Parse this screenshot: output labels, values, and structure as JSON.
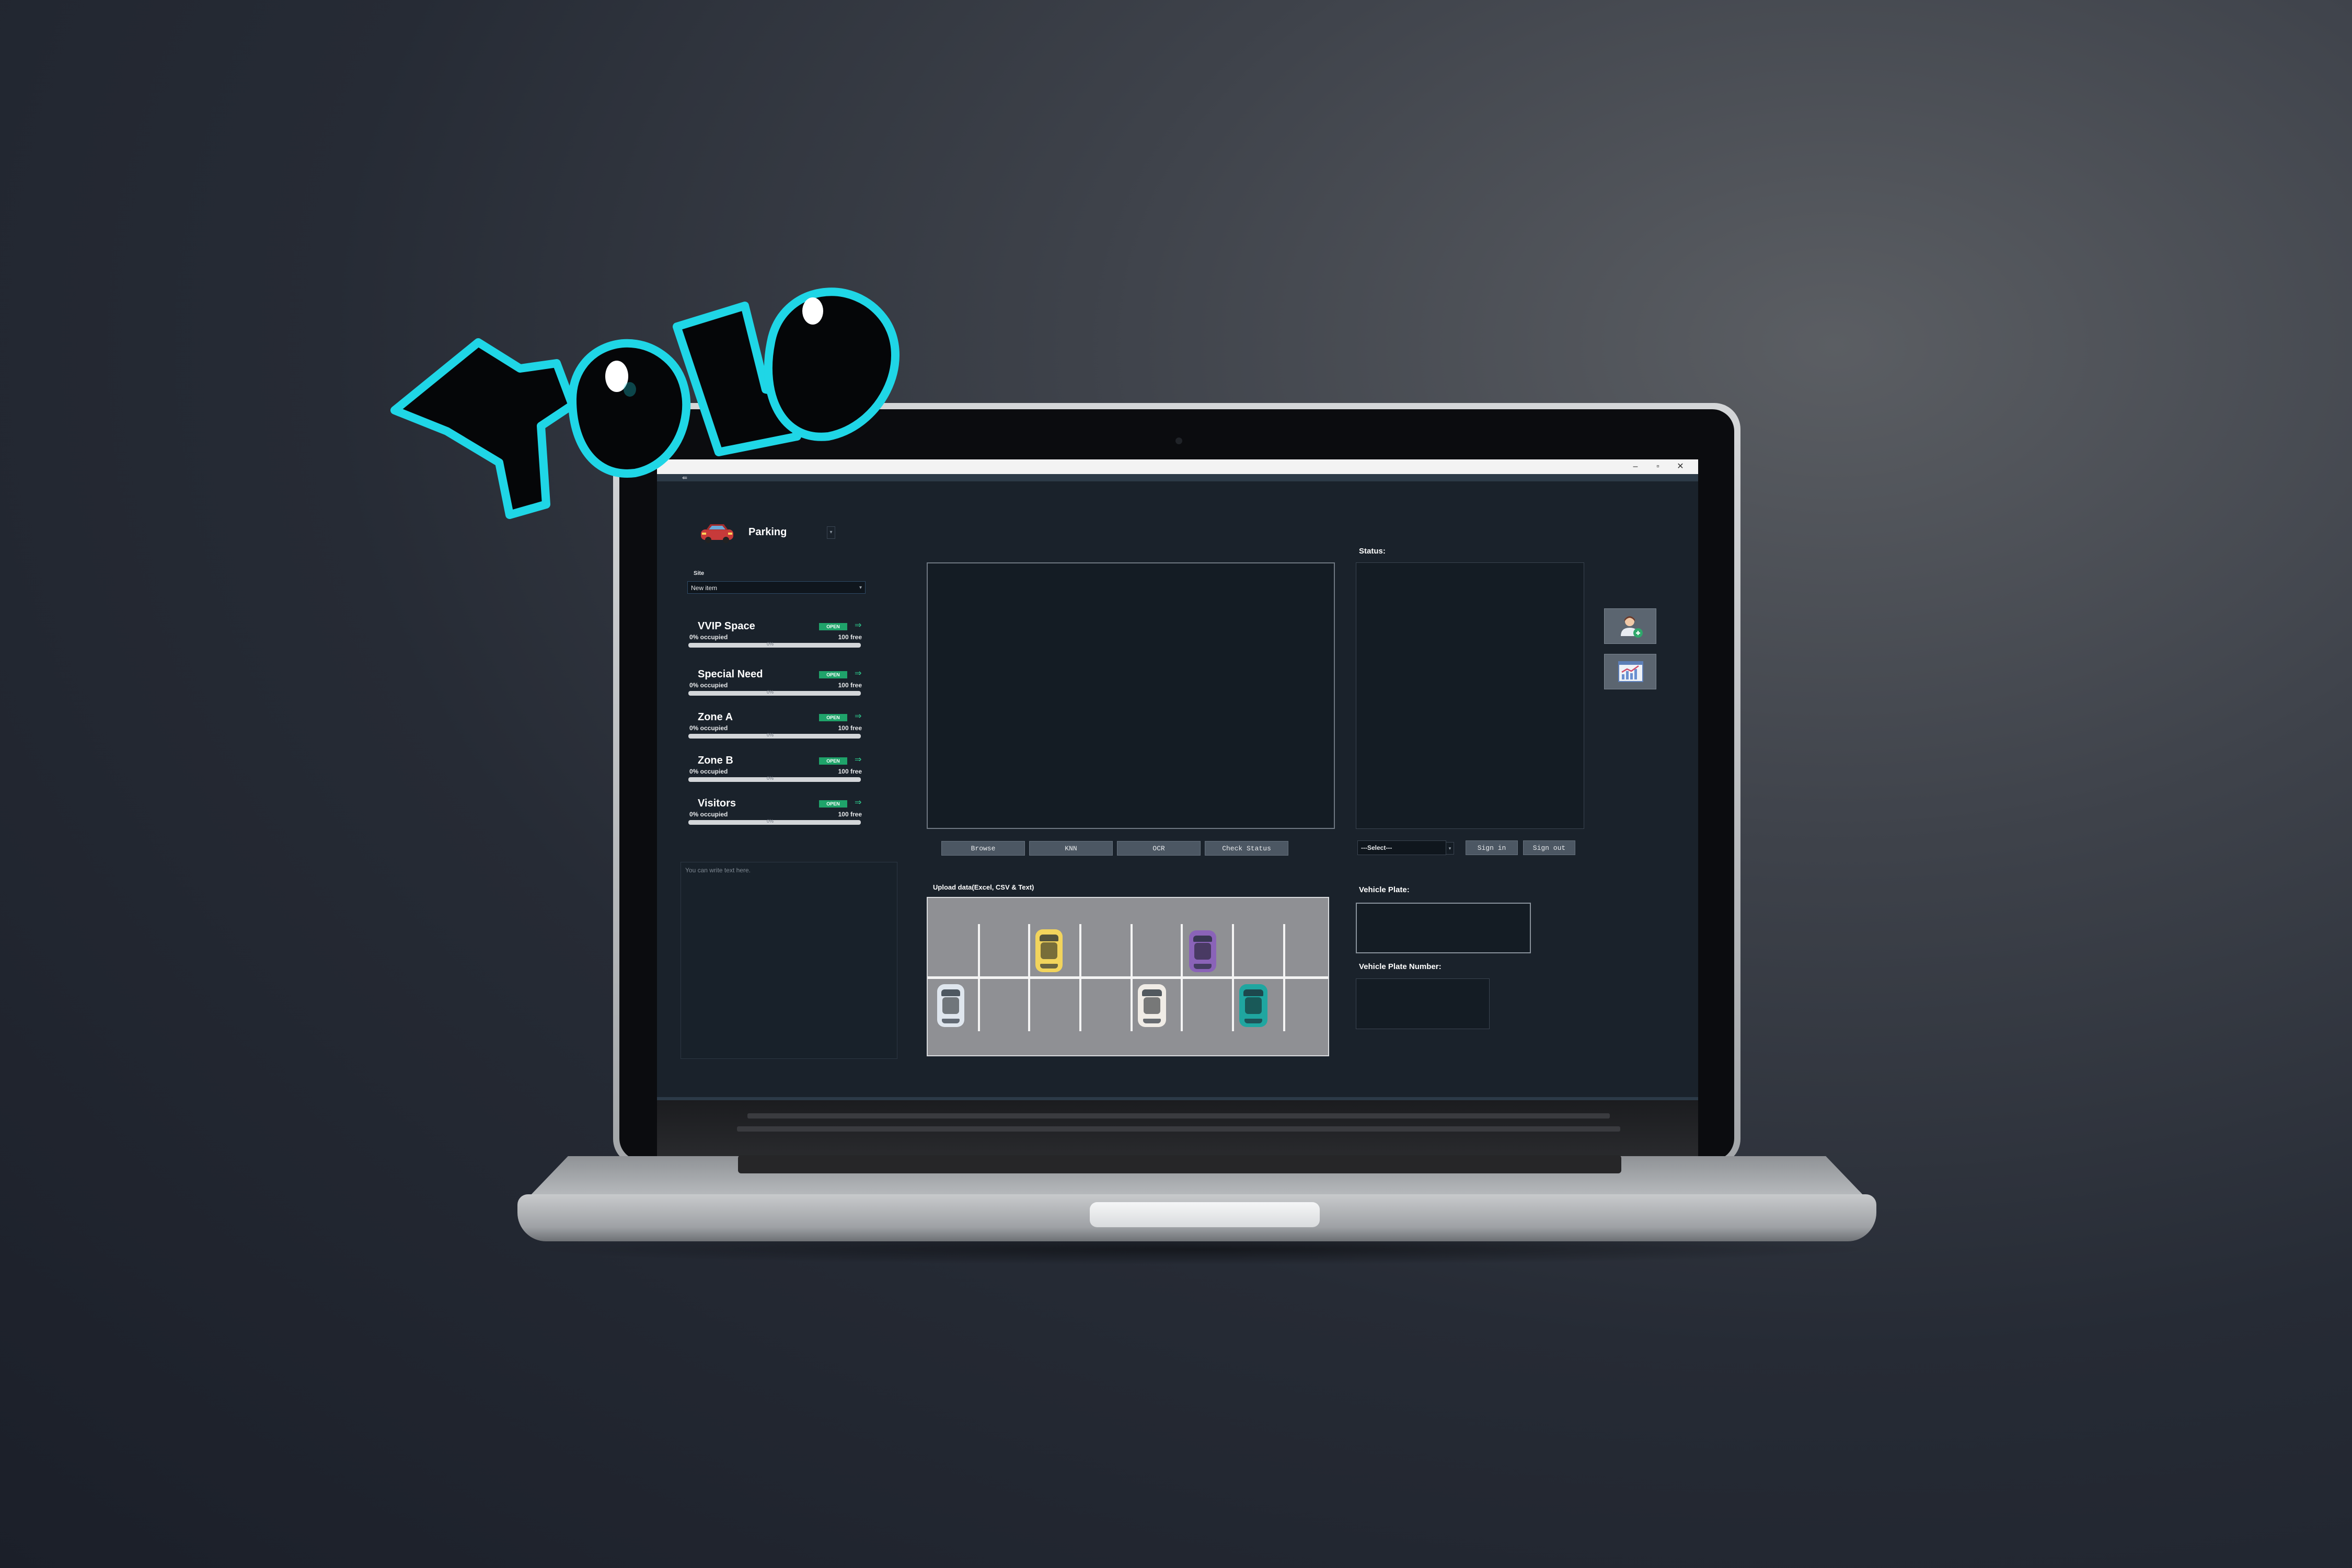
{
  "window": {
    "minimize": "–",
    "maximize": "▫",
    "close": "✕"
  },
  "nav": {
    "back": "⇚"
  },
  "app": {
    "title": "Parking",
    "dropdown_caret": "▾"
  },
  "site": {
    "label": "Site",
    "value": "New item",
    "caret": "▾"
  },
  "zones": [
    {
      "name": "VVIP Space",
      "status": "OPEN",
      "arrow": "⇒",
      "occupied": "0% occupied",
      "free": "100 free",
      "percent": "0%",
      "fill": 0
    },
    {
      "name": "Special Need",
      "status": "OPEN",
      "arrow": "⇒",
      "occupied": "0% occupied",
      "free": "100 free",
      "percent": "0%",
      "fill": 0
    },
    {
      "name": "Zone A",
      "status": "OPEN",
      "arrow": "⇒",
      "occupied": "0% occupied",
      "free": "100 free",
      "percent": "0%",
      "fill": 0
    },
    {
      "name": "Zone B",
      "status": "OPEN",
      "arrow": "⇒",
      "occupied": "0% occupied",
      "free": "100 free",
      "percent": "0%",
      "fill": 0
    },
    {
      "name": "Visitors",
      "status": "OPEN",
      "arrow": "⇒",
      "occupied": "0% occupied",
      "free": "100 free",
      "percent": "0%",
      "fill": 0
    }
  ],
  "notes": {
    "placeholder": "You can write text here."
  },
  "actions": {
    "browse": "Browse",
    "knn": "KNN",
    "ocr": "OCR",
    "check_status": "Check Status"
  },
  "status": {
    "label": "Status:"
  },
  "auth": {
    "select": "---Select---",
    "select_caret": "▾",
    "sign_in": "Sign in",
    "sign_out": "Sign out"
  },
  "upload": {
    "label": "Upload data(Excel, CSV & Text)"
  },
  "plate": {
    "label": "Vehicle Plate:",
    "number_label": "Vehicle Plate Number:"
  },
  "sticker": {
    "text": "YOLO"
  },
  "colors": {
    "accent": "#1fa36a",
    "brand_sticker": "#1fd6e6",
    "screen_bg": "#1a222b"
  },
  "icons": {
    "add_user": "add-user-icon",
    "analytics": "analytics-chart-icon",
    "car": "car-icon"
  },
  "parking_cars": [
    {
      "color": "#f2d45c"
    },
    {
      "color": "#8a63b8"
    },
    {
      "color": "#dfe6ee"
    },
    {
      "color": "#f0ece6"
    },
    {
      "color": "#1fa6a0"
    }
  ]
}
